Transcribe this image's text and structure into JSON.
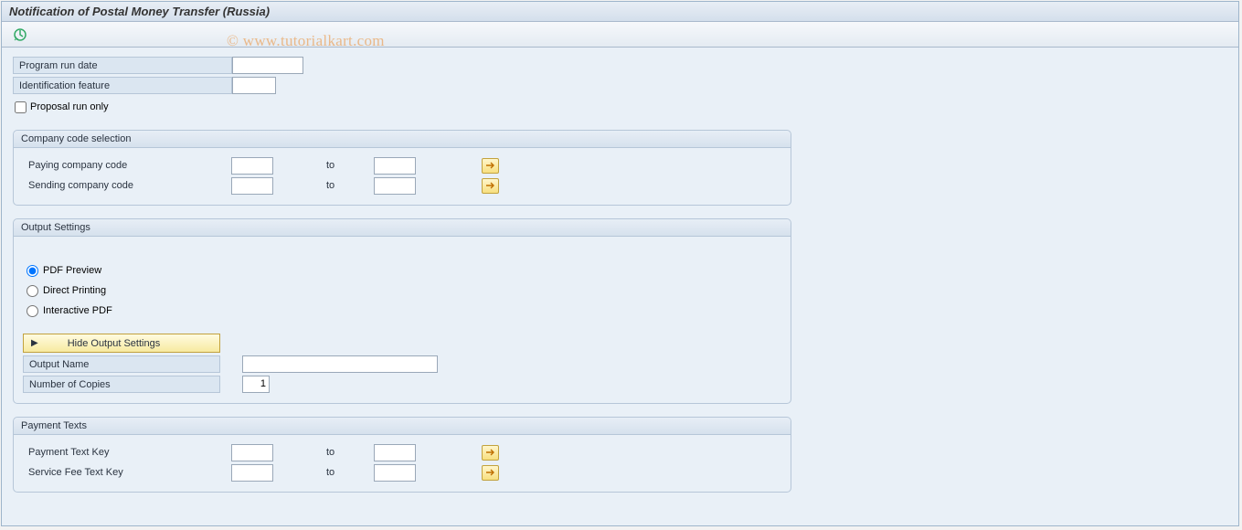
{
  "window": {
    "title": "Notification of Postal Money Transfer (Russia)"
  },
  "watermark": "© www.tutorialkart.com",
  "params": {
    "run_date_label": "Program run date",
    "run_date_value": "",
    "ident_label": "Identification feature",
    "ident_value": "",
    "proposal_label": "Proposal run only"
  },
  "company": {
    "group_title": "Company code selection",
    "paying_label": "Paying company code",
    "sending_label": "Sending company code",
    "to_label": "to",
    "paying_from": "",
    "paying_to": "",
    "sending_from": "",
    "sending_to": ""
  },
  "output": {
    "group_title": "Output Settings",
    "pdf_preview": "PDF Preview",
    "direct_printing": "Direct Printing",
    "interactive_pdf": "Interactive PDF",
    "hide_btn": "Hide Output Settings",
    "output_name_label": "Output Name",
    "output_name_value": "",
    "copies_label": "Number of Copies",
    "copies_value": "1"
  },
  "payment": {
    "group_title": "Payment Texts",
    "payment_key_label": "Payment Text Key",
    "service_fee_label": "Service Fee Text Key",
    "to_label": "to",
    "pay_from": "",
    "pay_to": "",
    "svc_from": "",
    "svc_to": ""
  }
}
